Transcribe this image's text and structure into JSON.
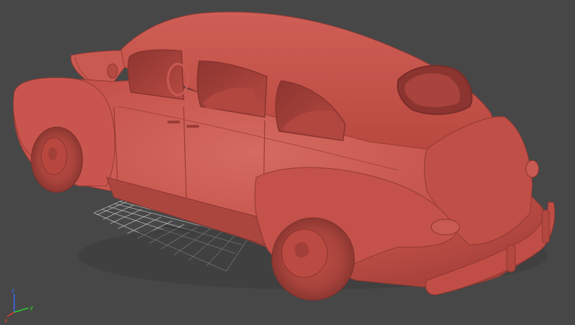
{
  "viewport": {
    "background_color": "#474747",
    "grid_color": "#b4b4b4",
    "model_color": "#c5534b",
    "model_shadow_color": "#9a3b35",
    "model_highlight_color": "#d86a60"
  },
  "axis_gizmo": {
    "x_label": "x",
    "y_label": "y",
    "z_label": "z",
    "x_color": "#e03a2a",
    "y_color": "#2bd12b",
    "z_color": "#3a6cff"
  }
}
